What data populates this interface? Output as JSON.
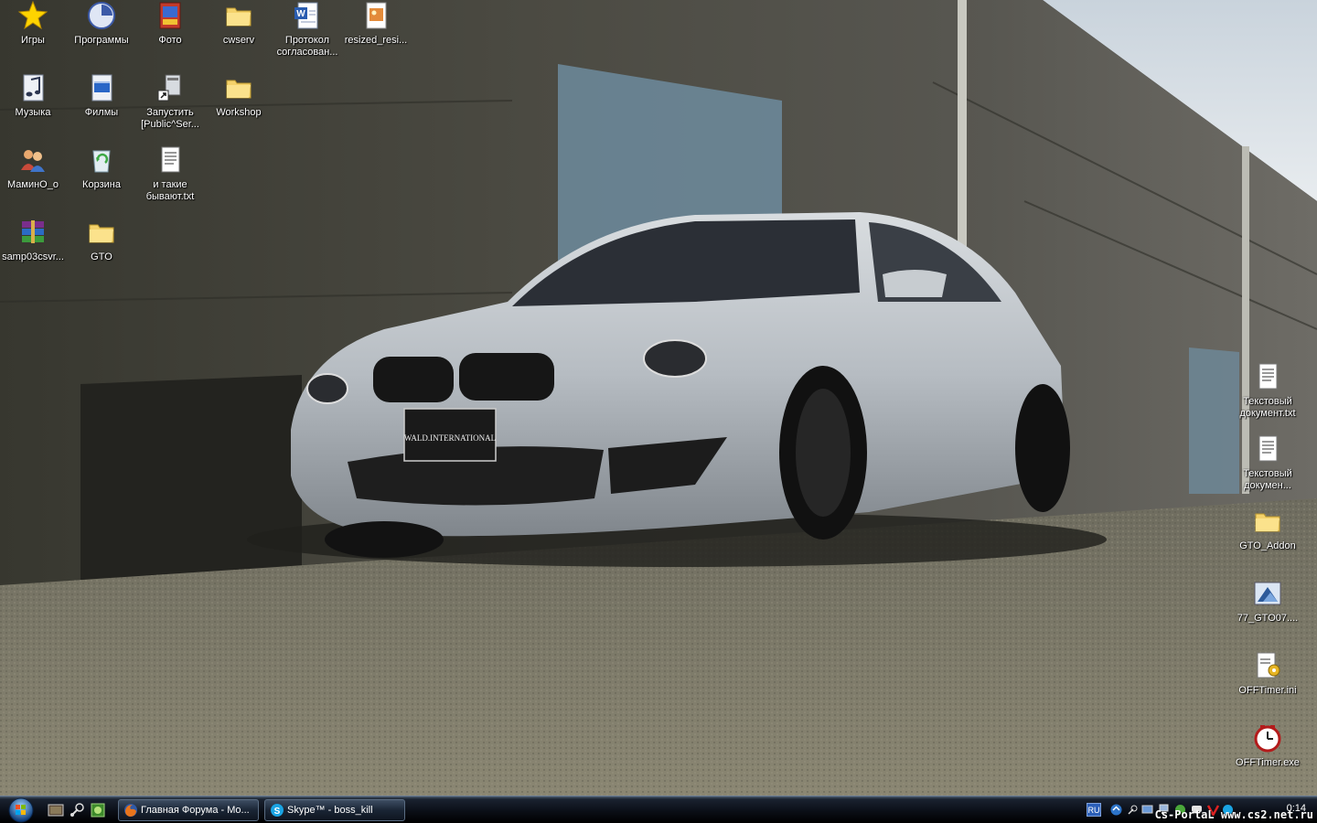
{
  "desktop": {
    "icons": [
      {
        "label": "Игры",
        "icon": "star-icon"
      },
      {
        "label": "Программы",
        "icon": "programs-icon"
      },
      {
        "label": "Фото",
        "icon": "photo-icon"
      },
      {
        "label": "cwserv",
        "icon": "folder-icon"
      },
      {
        "label": "Протокол согласован...",
        "icon": "word-doc-icon"
      },
      {
        "label": "resized_resi...",
        "icon": "image-file-icon"
      },
      {
        "label": "Музыка",
        "icon": "music-icon"
      },
      {
        "label": "Филмы",
        "icon": "video-icon"
      },
      {
        "label": "Запустить [Public^Ser...",
        "icon": "shortcut-app-icon"
      },
      {
        "label": "Workshop",
        "icon": "folder-icon"
      },
      {
        "label": "МаминО_о",
        "icon": "users-icon"
      },
      {
        "label": "Корзина",
        "icon": "recycle-bin-icon"
      },
      {
        "label": "и такие бывают.txt",
        "icon": "text-file-icon"
      },
      {
        "label": "samp03csvr...",
        "icon": "winrar-icon"
      },
      {
        "label": "GTO",
        "icon": "folder-icon"
      },
      {
        "label": "Текстовый документ.txt",
        "icon": "text-file-icon"
      },
      {
        "label": "Текстовый докумен...",
        "icon": "text-file-icon"
      },
      {
        "label": "GTO_Addon",
        "icon": "folder-icon"
      },
      {
        "label": "77_GTO07....",
        "icon": "image-file-icon"
      },
      {
        "label": "OFFTimer.ini",
        "icon": "ini-file-icon"
      },
      {
        "label": "OFFTimer.exe",
        "icon": "clock-app-icon"
      }
    ],
    "wallpaper_badge": "WALD.INTERNATIONAL"
  },
  "taskbar": {
    "start_icon": "windows-orb-icon",
    "quick_launch": [
      "show-desktop-icon",
      "steam-icon",
      "green-app-icon"
    ],
    "tasks": [
      {
        "label": "Главная Форума - Mo...",
        "icon": "firefox-icon"
      },
      {
        "label": "Skype™ - boss_kill",
        "icon": "skype-icon"
      }
    ],
    "tray": {
      "language": "RU",
      "clock": "0:14",
      "watermark": "Cs-PortaL www.cs2.net.ru"
    }
  }
}
